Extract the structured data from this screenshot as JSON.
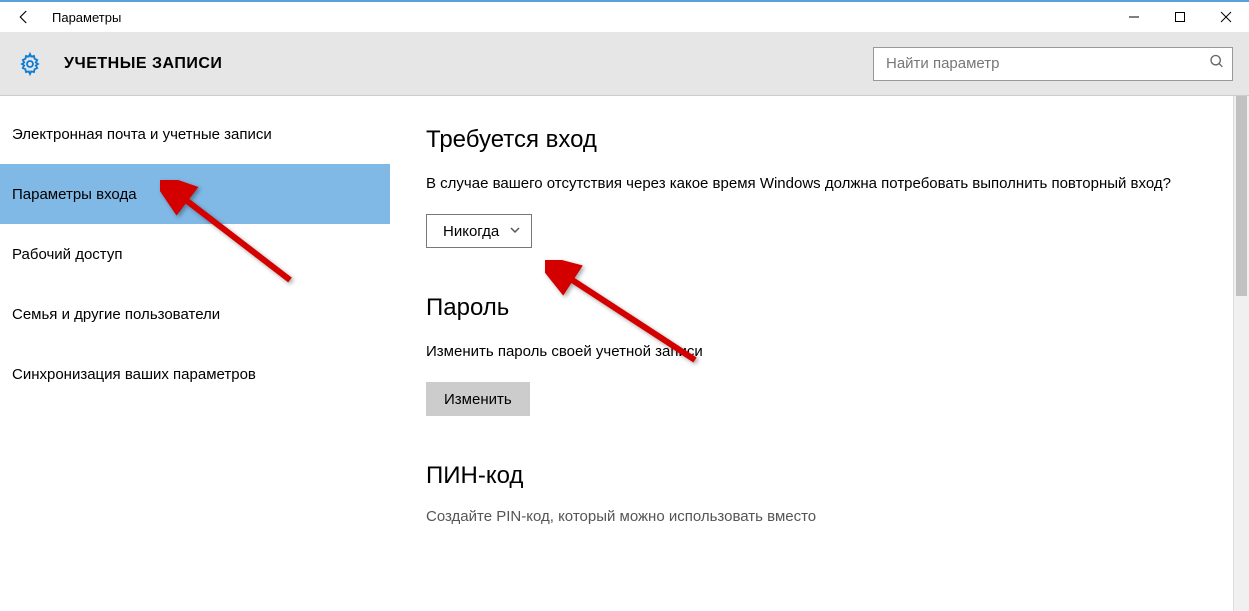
{
  "window": {
    "title": "Параметры"
  },
  "header": {
    "title": "УЧЕТНЫЕ ЗАПИСИ",
    "search_placeholder": "Найти параметр"
  },
  "sidebar": {
    "items": [
      {
        "label": "Электронная почта и учетные записи"
      },
      {
        "label": "Параметры входа"
      },
      {
        "label": "Рабочий доступ"
      },
      {
        "label": "Семья и другие пользователи"
      },
      {
        "label": "Синхронизация ваших параметров"
      }
    ],
    "selected_index": 1
  },
  "content": {
    "section1_title": "Требуется вход",
    "section1_desc": "В случае вашего отсутствия через какое время Windows должна потребовать выполнить повторный вход?",
    "dropdown_value": "Никогда",
    "section2_title": "Пароль",
    "section2_desc": "Изменить пароль своей учетной записи",
    "change_button": "Изменить",
    "section3_title": "ПИН-код",
    "section3_cutoff": "Создайте PIN-код, который можно использовать вместо"
  }
}
